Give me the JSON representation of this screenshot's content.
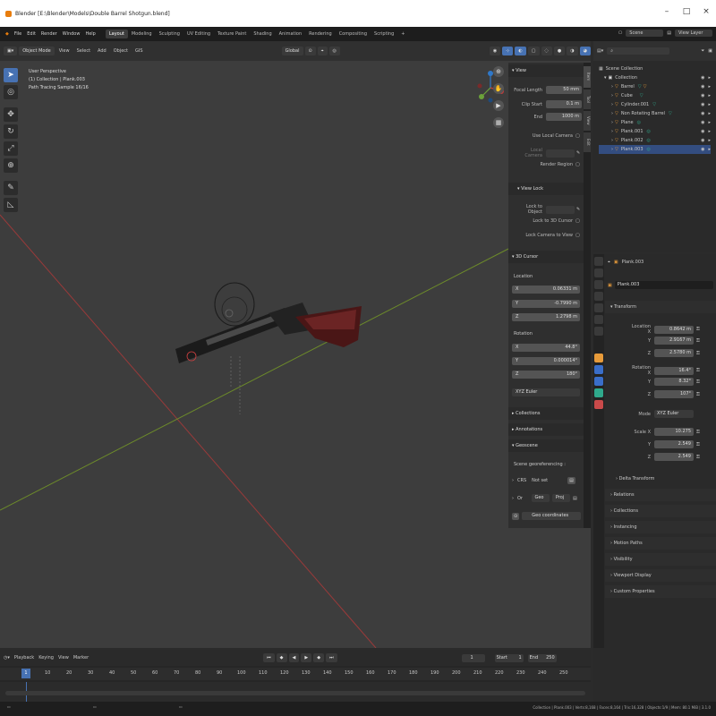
{
  "window": {
    "title": "Blender [E:\\Blender\\Models\\Double Barrel Shotgun.blend]"
  },
  "menus": [
    "File",
    "Edit",
    "Render",
    "Window",
    "Help"
  ],
  "workspaces": [
    "Layout",
    "Modeling",
    "Sculpting",
    "UV Editing",
    "Texture Paint",
    "Shading",
    "Animation",
    "Rendering",
    "Compositing",
    "Scripting"
  ],
  "add_workspace": "+",
  "scene": "Scene",
  "view_layer": "View Layer",
  "viewport_header": {
    "mode": "Object Mode",
    "menus": [
      "View",
      "Select",
      "Add",
      "Object",
      "GIS"
    ],
    "orientation": "Global"
  },
  "viewport_info": [
    "User Perspective",
    "(1) Collection | Plank.003",
    "Path Tracing Sample 16/16"
  ],
  "npanel": {
    "view_title": "View",
    "focal_length_label": "Focal Length",
    "focal_length": "50 mm",
    "clip_start_label": "Clip Start",
    "clip_start": "0.1 m",
    "end_label": "End",
    "end": "1000 m",
    "use_local_camera": "Use Local Camera",
    "local_camera": "Local Camera",
    "render_region": "Render Region",
    "view_lock": "View Lock",
    "lock_to_object": "Lock to Object",
    "lock_to_3d_cursor": "Lock to 3D Cursor",
    "lock_camera_to_view": "Lock Camera to View",
    "cursor_title": "3D Cursor",
    "location_label": "Location",
    "loc": [
      {
        "axis": "X",
        "value": "0.06331 m"
      },
      {
        "axis": "Y",
        "value": "-0.7990 m"
      },
      {
        "axis": "Z",
        "value": "1.2798 m"
      }
    ],
    "rotation_label": "Rotation",
    "rot": [
      {
        "axis": "X",
        "value": "44.8°"
      },
      {
        "axis": "Y",
        "value": "0.000014°"
      },
      {
        "axis": "Z",
        "value": "180°"
      }
    ],
    "rotation_mode": "XYZ Euler",
    "collections": "Collections",
    "annotations": "Annotations",
    "geoscene": "Geoscene",
    "scene_georef": "Scene georeferencing :",
    "crs_label": "CRS",
    "crs_value": "Not set",
    "origin_label": "Or",
    "origin_geo": "Geo",
    "origin_proj": "Proj",
    "geo_coords": "Geo coordinates"
  },
  "npanel_tabs": [
    "Item",
    "Tool",
    "View",
    "Edit"
  ],
  "outliner": {
    "title": "Scene Collection",
    "items": [
      {
        "name": "Collection",
        "depth": 0
      },
      {
        "name": "Barrel",
        "depth": 1
      },
      {
        "name": "Cube",
        "depth": 1
      },
      {
        "name": "Cylinder.001",
        "depth": 1
      },
      {
        "name": "Non Rotating Barrel",
        "depth": 1
      },
      {
        "name": "Plane",
        "depth": 1
      },
      {
        "name": "Plank.001",
        "depth": 1
      },
      {
        "name": "Plank.002",
        "depth": 1
      },
      {
        "name": "Plank.003",
        "depth": 1
      }
    ]
  },
  "properties": {
    "object_name": "Plank.003",
    "object_field": "Plank.003",
    "transform": "Transform",
    "loc_labels": [
      "Location X",
      "Y",
      "Z"
    ],
    "loc": [
      "0.8642 m",
      "2.9167 m",
      "2.5780 m"
    ],
    "rot_labels": [
      "Rotation X",
      "Y",
      "Z"
    ],
    "rot": [
      "16.4°",
      "8.32°",
      "107°"
    ],
    "mode_label": "Mode",
    "mode": "XYZ Euler",
    "scale_labels": [
      "Scale X",
      "Y",
      "Z"
    ],
    "scale": [
      "10.275",
      "2.549",
      "2.549"
    ],
    "delta": "Delta Transform",
    "sections": [
      "Relations",
      "Collections",
      "Instancing",
      "Motion Paths",
      "Visibility",
      "Viewport Display",
      "Custom Properties"
    ]
  },
  "timeline": {
    "menus": [
      "Playback",
      "Keying",
      "View",
      "Marker"
    ],
    "current": "1",
    "start_label": "Start",
    "start": "1",
    "end_label": "End",
    "end": "250",
    "ticks": [
      "10",
      "20",
      "30",
      "40",
      "50",
      "60",
      "70",
      "80",
      "90",
      "100",
      "110",
      "120",
      "130",
      "140",
      "150",
      "160",
      "170",
      "180",
      "190",
      "200",
      "210",
      "220",
      "230",
      "240",
      "250"
    ]
  },
  "status": "Collection | Plank.003 | Verts:8,168 | Faces:8,164 | Tris:16,328 | Objects:1/9 | Mem: 80.1 MiB | 3.1.0"
}
